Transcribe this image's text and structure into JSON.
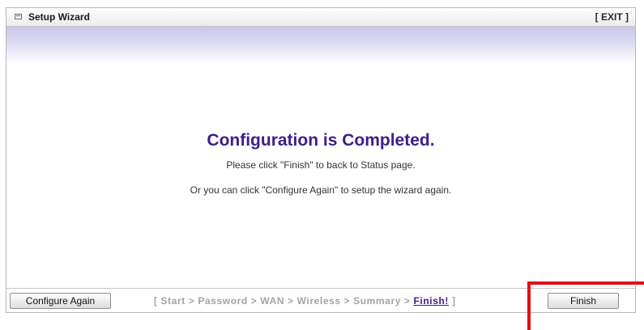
{
  "header": {
    "title": "Setup Wizard",
    "exit_label": "[ EXIT ]"
  },
  "main": {
    "heading": "Configuration is Completed.",
    "message_1": "Please click \"Finish\" to back to Status page.",
    "message_2": "Or you can click \"Configure Again\" to setup the wizard again."
  },
  "footer": {
    "configure_again_label": "Configure Again",
    "finish_label": "Finish",
    "steps_prefix": "[ Start > Password > WAN > Wireless > Summary > ",
    "steps_current": "Finish!",
    "steps_suffix": " ]"
  },
  "colors": {
    "accent": "#3d1d8c",
    "highlight": "#e0101a",
    "band_top": "#c9c6ea"
  }
}
